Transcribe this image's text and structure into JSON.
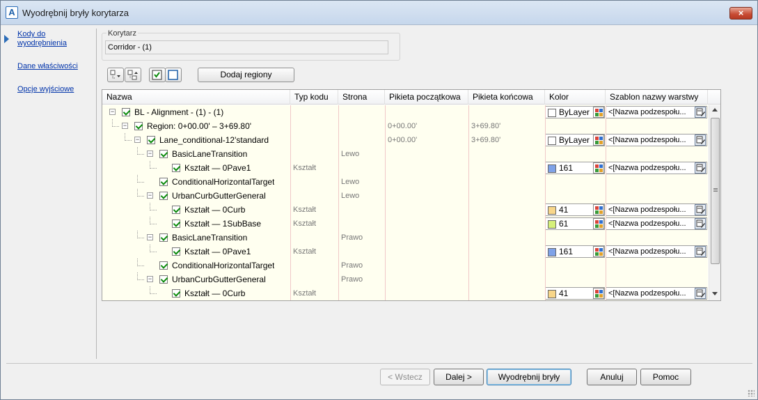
{
  "window": {
    "title": "Wyodrębnij bryły korytarza",
    "close_label": "×"
  },
  "nav": {
    "items": [
      {
        "label": "Kody do wyodrębnienia",
        "active": true
      },
      {
        "label": "Dane właściwości",
        "active": false
      },
      {
        "label": "Opcje wyjściowe",
        "active": false
      }
    ]
  },
  "corridor": {
    "group_label": "Korytarz",
    "value": "Corridor - (1)"
  },
  "toolbar": {
    "add_regions_label": "Dodaj regiony"
  },
  "grid": {
    "columns": [
      "Nazwa",
      "Typ kodu",
      "Strona",
      "Pikieta początkowa",
      "Pikieta końcowa",
      "Kolor",
      "Szablon nazwy warstwy"
    ],
    "rows": [
      {
        "name": "BL - Alignment - (1) - (1)",
        "type": "",
        "side": "",
        "start": "",
        "end": "",
        "color": "ByLayer",
        "layer": "<[Nazwa podzespołu..."
      },
      {
        "name": "Region: 0+00.00' – 3+69.80'",
        "type": "",
        "side": "",
        "start": "0+00.00'",
        "end": "3+69.80'",
        "color": "",
        "layer": ""
      },
      {
        "name": "Lane_conditional-12'standard",
        "type": "",
        "side": "",
        "start": "0+00.00'",
        "end": "3+69.80'",
        "color": "ByLayer",
        "layer": "<[Nazwa podzespołu..."
      },
      {
        "name": "BasicLaneTransition",
        "type": "",
        "side": "Lewo",
        "start": "",
        "end": "",
        "color": "",
        "layer": ""
      },
      {
        "name": "Kształt — 0Pave1",
        "type": "Kształt",
        "side": "",
        "start": "",
        "end": "",
        "color": "161",
        "layer": "<[Nazwa podzespołu..."
      },
      {
        "name": "ConditionalHorizontalTarget",
        "type": "",
        "side": "Lewo",
        "start": "",
        "end": "",
        "color": "",
        "layer": ""
      },
      {
        "name": "UrbanCurbGutterGeneral",
        "type": "",
        "side": "Lewo",
        "start": "",
        "end": "",
        "color": "",
        "layer": ""
      },
      {
        "name": "Kształt — 0Curb",
        "type": "Kształt",
        "side": "",
        "start": "",
        "end": "",
        "color": "41",
        "layer": "<[Nazwa podzespołu..."
      },
      {
        "name": "Kształt — 1SubBase",
        "type": "Kształt",
        "side": "",
        "start": "",
        "end": "",
        "color": "61",
        "layer": "<[Nazwa podzespołu..."
      },
      {
        "name": "BasicLaneTransition",
        "type": "",
        "side": "Prawo",
        "start": "",
        "end": "",
        "color": "",
        "layer": ""
      },
      {
        "name": "Kształt — 0Pave1",
        "type": "Kształt",
        "side": "",
        "start": "",
        "end": "",
        "color": "161",
        "layer": "<[Nazwa podzespołu..."
      },
      {
        "name": "ConditionalHorizontalTarget",
        "type": "",
        "side": "Prawo",
        "start": "",
        "end": "",
        "color": "",
        "layer": ""
      },
      {
        "name": "UrbanCurbGutterGeneral",
        "type": "",
        "side": "Prawo",
        "start": "",
        "end": "",
        "color": "",
        "layer": ""
      },
      {
        "name": "Kształt — 0Curb",
        "type": "Kształt",
        "side": "",
        "start": "",
        "end": "",
        "color": "41",
        "layer": "<[Nazwa podzespołu..."
      }
    ]
  },
  "colors": {
    "ByLayer": "#ffffff",
    "161": "#7fa2e8",
    "41": "#f8d68a",
    "61": "#d6f07a"
  },
  "buttons": {
    "back": "< Wstecz",
    "next": "Dalej >",
    "extract": "Wyodrębnij bryły",
    "cancel": "Anuluj",
    "help": "Pomoc"
  }
}
